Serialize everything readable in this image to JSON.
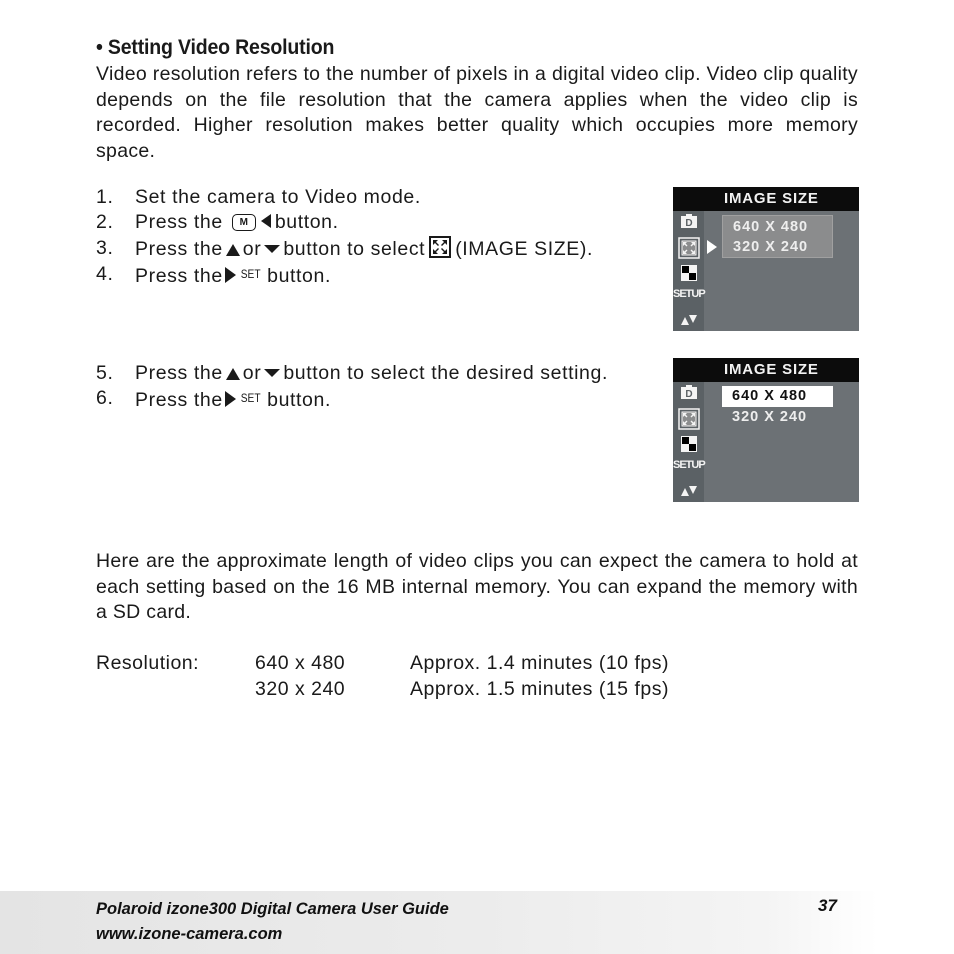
{
  "section": {
    "heading": "• Setting Video Resolution",
    "intro": "Video resolution refers to the number of pixels in a digital video clip. Video clip quality depends on the file resolution that the camera applies when the video clip is recorded. Higher resolution makes better quality which occupies more memory space."
  },
  "steps_group1": [
    {
      "num": "1.",
      "text": "Set the camera to Video mode."
    },
    {
      "num": "2.",
      "pre": "Press the",
      "icon_m": "M",
      "post": "button."
    },
    {
      "num": "3.",
      "pre": "Press the",
      "mid": "or",
      "post1": "button to select",
      "post2": "(IMAGE SIZE)."
    },
    {
      "num": "4.",
      "pre": "Press the",
      "set": "SET",
      "post": "button."
    }
  ],
  "steps_group2": [
    {
      "num": "5.",
      "pre": "Press the",
      "mid": "or",
      "post": "button to select the desired setting."
    },
    {
      "num": "6.",
      "pre": "Press the",
      "set": "SET",
      "post": "button."
    }
  ],
  "icons": {
    "up": "triangle-up-icon",
    "down": "triangle-down-icon",
    "left": "triangle-left-icon",
    "right": "triangle-right-icon",
    "menu": "m-button-icon",
    "image_size": "image-size-icon"
  },
  "camera_screens": [
    {
      "title": "IMAGE SIZE",
      "options": [
        "640 X 480",
        "320 X 240"
      ],
      "state": "submenu-pointer",
      "sidebar": [
        "camera-d-icon",
        "image-size-icon",
        "quality-icon",
        "SETUP",
        "up-down-icon"
      ]
    },
    {
      "title": "IMAGE SIZE",
      "options": [
        "640 X 480",
        "320 X 240"
      ],
      "selected": "640 X 480",
      "state": "option-selected",
      "sidebar": [
        "camera-d-icon",
        "image-size-icon",
        "quality-icon",
        "SETUP",
        "up-down-icon"
      ]
    }
  ],
  "sidebar_setup_label": "SETUP",
  "capacity_text": "Here are the approximate length of video clips you can expect the camera to hold at each setting based on the 16 MB internal memory. You can expand the memory with a SD card.",
  "resolution_table": {
    "label": "Resolution:",
    "rows": [
      {
        "size": "640 x 480",
        "length": "Approx. 1.4 minutes (10 fps)"
      },
      {
        "size": "320 x 240",
        "length": "Approx. 1.5 minutes (15 fps)"
      }
    ]
  },
  "footer": {
    "title": "Polaroid izone300 Digital Camera User Guide",
    "url": "www.izone-camera.com",
    "page_number": "37"
  },
  "colors": {
    "screen_header": "#0c0c0c",
    "screen_bg": "#6c7175",
    "screen_sidebar": "#5b6165",
    "option_box": "#8b8c8d",
    "highlight": "#ffffff"
  }
}
